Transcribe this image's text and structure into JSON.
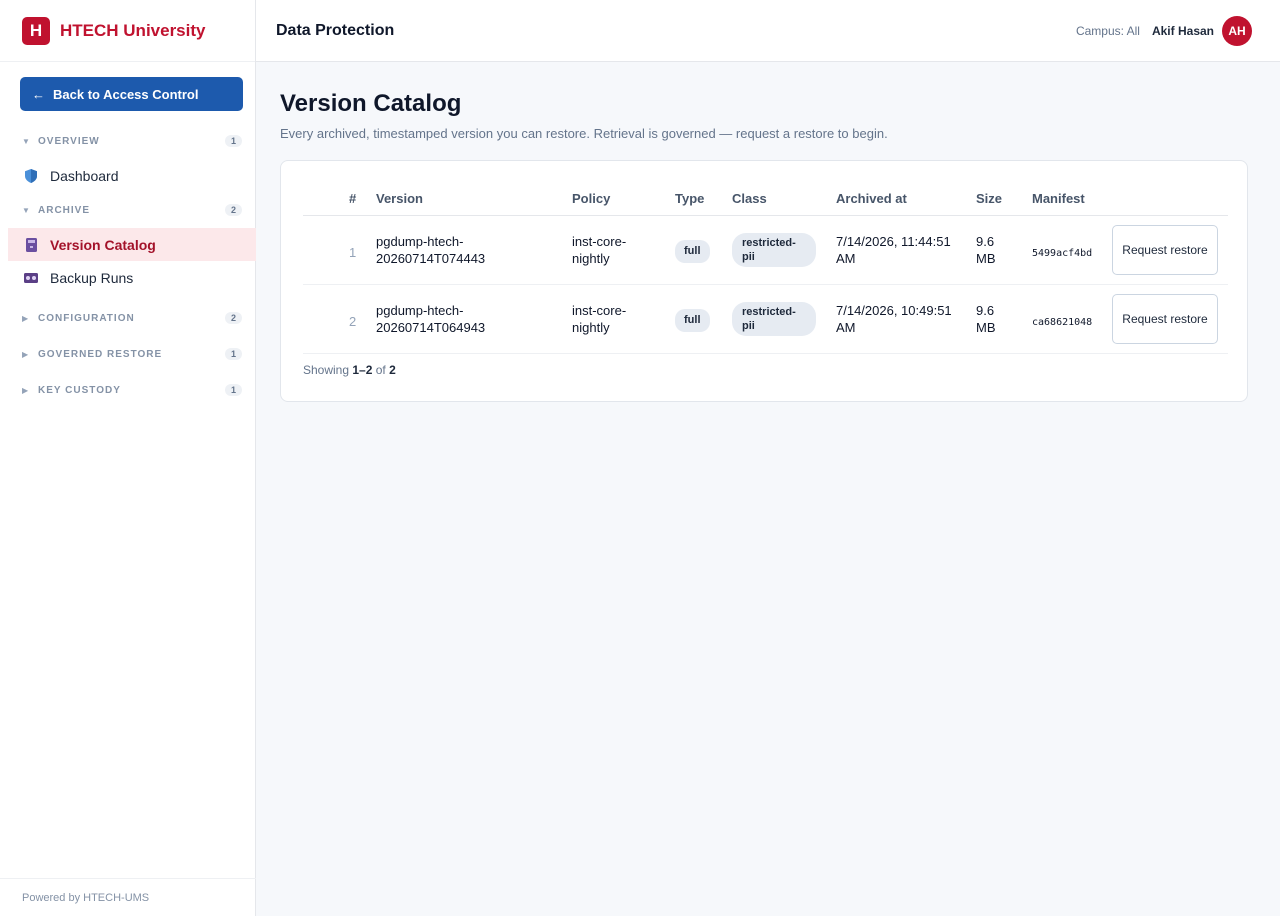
{
  "brand": {
    "logo_letter": "H",
    "name": "HTECH University",
    "color": "#c0122f"
  },
  "sidebar": {
    "back_label": "Back to Access Control",
    "sections": [
      {
        "title": "OVERVIEW",
        "count": "1",
        "expanded": true,
        "items": [
          {
            "label": "Dashboard",
            "icon": "shield-icon"
          }
        ]
      },
      {
        "title": "ARCHIVE",
        "count": "2",
        "expanded": true,
        "items": [
          {
            "label": "Version Catalog",
            "icon": "archive-icon",
            "active": true
          },
          {
            "label": "Backup Runs",
            "icon": "tape-icon"
          }
        ]
      },
      {
        "title": "CONFIGURATION",
        "count": "2",
        "expanded": false
      },
      {
        "title": "GOVERNED RESTORE",
        "count": "1",
        "expanded": false
      },
      {
        "title": "KEY CUSTODY",
        "count": "1",
        "expanded": false
      }
    ],
    "footer": "Powered by HTECH-UMS"
  },
  "header": {
    "title": "Data Protection",
    "campus": "Campus: All",
    "user_name": "Akif Hasan",
    "avatar_initials": "AH"
  },
  "page": {
    "title": "Version Catalog",
    "subtitle": "Every archived, timestamped version you can restore. Retrieval is governed — request a restore to begin."
  },
  "table": {
    "columns": [
      "#",
      "Version",
      "Policy",
      "Type",
      "Class",
      "Archived at",
      "Size",
      "Manifest"
    ],
    "rows": [
      {
        "num": "1",
        "version_a": "pgdump-htech-",
        "version_b": "20260714T074443",
        "policy_a": "inst-core-",
        "policy_b": "nightly",
        "type": "full",
        "class_a": "restricted-",
        "class_b": "pii",
        "archived_a": "7/14/2026, 11:44:51",
        "archived_b": "AM",
        "size_a": "9.6",
        "size_b": "MB",
        "manifest": "5499acf4bd",
        "action": "Request restore"
      },
      {
        "num": "2",
        "version_a": "pgdump-htech-",
        "version_b": "20260714T064943",
        "policy_a": "inst-core-",
        "policy_b": "nightly",
        "type": "full",
        "class_a": "restricted-",
        "class_b": "pii",
        "archived_a": "7/14/2026, 10:49:51",
        "archived_b": "AM",
        "size_a": "9.6",
        "size_b": "MB",
        "manifest": "ca68621048",
        "action": "Request restore"
      }
    ],
    "showing_prefix": "Showing",
    "showing_range": "1–2",
    "showing_of": "of",
    "showing_total": "2"
  }
}
